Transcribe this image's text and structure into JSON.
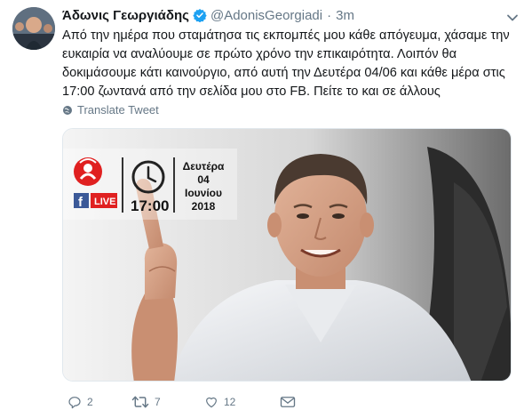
{
  "tweet": {
    "author_name": "Άδωνις Γεωργιάδης",
    "author_handle": "@AdonisGeorgiadi",
    "separator": "·",
    "time": "3m",
    "text_lines": [
      "Από την ημέρα που σταμάτησα τις εκπομπές μου κάθε απόγευμα, χάσαμε την",
      "ευκαιρία να αναλύουμε σε πρώτο χρόνο την επικαιρότητα. Λοιπόν θα",
      "δοκιμάσουμε κάτι καινούργιο, από αυτή την Δευτέρα 04/06 και κάθε μέρα στις",
      "17:00 ζωντανά από την σελίδα μου στο FB. Πείτε το και σε άλλους"
    ],
    "translate_label": "Translate Tweet",
    "reply_count": "2",
    "retweet_count": "7",
    "like_count": "12"
  },
  "media": {
    "live_label": "LIVE",
    "fb_letter": "f",
    "clock_time": "17:00",
    "date_lines": [
      "Δευτέρα",
      "04",
      "Ιουνίου",
      "2018"
    ]
  },
  "colors": {
    "verified": "#1da1f2",
    "live_red": "#e02020",
    "facebook_blue": "#3b5998",
    "muted": "#657786",
    "text": "#14171a"
  },
  "icons": {
    "reply": "reply-icon",
    "retweet": "retweet-icon",
    "like": "heart-icon",
    "dm": "envelope-icon",
    "translate": "globe-icon",
    "verified": "verified-badge-icon",
    "caret": "chevron-down-icon"
  }
}
